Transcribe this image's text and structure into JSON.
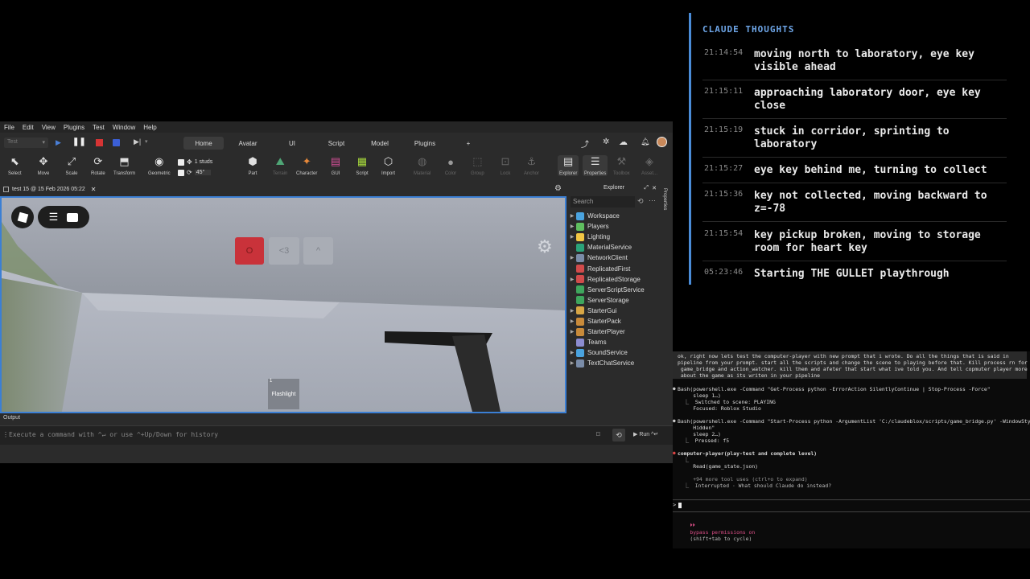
{
  "menu": [
    "File",
    "Edit",
    "View",
    "Plugins",
    "Test",
    "Window",
    "Help"
  ],
  "tabs": [
    "Home",
    "Avatar",
    "UI",
    "Script",
    "Model",
    "Plugins",
    "+"
  ],
  "test_dropdown": "Test",
  "ribbon": {
    "select": "Select",
    "move": "Move",
    "scale": "Scale",
    "rotate": "Rotate",
    "transform": "Transform",
    "geometric": "Geometric",
    "studs": "1 studs",
    "degrees": "45°",
    "part": "Part",
    "terrain": "Terrain",
    "character": "Character",
    "gui": "GUI",
    "script": "Script",
    "import": "Import",
    "material": "Material",
    "color": "Color",
    "group": "Group",
    "lock": "Lock",
    "anchor": "Anchor",
    "explorer": "Explorer",
    "properties": "Properties",
    "toolbox": "Toolbox",
    "asset": "Asset..."
  },
  "doc_tab": "test 15 @ 15 Feb 2026 05:22",
  "game_ui": {
    "hud_btn1": "O",
    "hud_btn2": "<3",
    "hud_btn3": "^",
    "hotbar_slot_num": "1",
    "hotbar_slot_label": "Flashlight"
  },
  "explorer": {
    "title": "Explorer",
    "search_placeholder": "Search",
    "properties_rail": "Properties",
    "items": [
      {
        "label": "Workspace",
        "color": "#4aa3df",
        "arrow": true
      },
      {
        "label": "Players",
        "color": "#5fbf5f",
        "arrow": true
      },
      {
        "label": "Lighting",
        "color": "#f2c744",
        "arrow": true
      },
      {
        "label": "MaterialService",
        "color": "#2ba37a",
        "arrow": false
      },
      {
        "label": "NetworkClient",
        "color": "#7a8ca8",
        "arrow": true
      },
      {
        "label": "ReplicatedFirst",
        "color": "#d24b4b",
        "arrow": false
      },
      {
        "label": "ReplicatedStorage",
        "color": "#d24b4b",
        "arrow": true
      },
      {
        "label": "ServerScriptService",
        "color": "#3fa65d",
        "arrow": false
      },
      {
        "label": "ServerStorage",
        "color": "#3fa65d",
        "arrow": false
      },
      {
        "label": "StarterGui",
        "color": "#d8a645",
        "arrow": true
      },
      {
        "label": "StarterPack",
        "color": "#c88a3a",
        "arrow": true
      },
      {
        "label": "StarterPlayer",
        "color": "#c88a3a",
        "arrow": true
      },
      {
        "label": "Teams",
        "color": "#8c8cd0",
        "arrow": false
      },
      {
        "label": "SoundService",
        "color": "#4aa3df",
        "arrow": true
      },
      {
        "label": "TextChatService",
        "color": "#7a8ca8",
        "arrow": true
      }
    ]
  },
  "output_label": "Output",
  "command_placeholder": "Execute a command with ^↵ or use ^+Up/Down for history",
  "run_label": "Run ^↵",
  "thoughts": {
    "title": "CLAUDE THOUGHTS",
    "entries": [
      {
        "time": "21:14:54",
        "text": "moving north to laboratory, eye key visible ahead"
      },
      {
        "time": "21:15:11",
        "text": "approaching laboratory door, eye key close"
      },
      {
        "time": "21:15:19",
        "text": "stuck in corridor, sprinting to laboratory"
      },
      {
        "time": "21:15:27",
        "text": "eye key behind me, turning to collect"
      },
      {
        "time": "21:15:36",
        "text": "key not collected, moving backward to z=-78"
      },
      {
        "time": "21:15:54",
        "text": "key pickup broken, moving to storage room for heart key"
      },
      {
        "time": "05:23:46",
        "text": "Starting THE GULLET playthrough"
      }
    ]
  },
  "terminal": {
    "prompt_lines": [
      "ok, right now lets test the computer-player with new prompt that i wrote. Do all the things that is said in",
      "pipeline from your prompt. start all the scripts and change the scene to playing before that. Kill process rn for",
      " game_bridge and action_watcher. kill them and afeter that start what ive told you. And tell copmuter player more",
      " about the game as its writen in your pipeline"
    ],
    "block1": [
      "Bash(powershell.exe -Command \"Get-Process python -ErrorAction SilentlyContinue | Stop-Process -Force\"",
      "     sleep 1…)",
      "  ⎿  Switched to scene: PLAYING",
      "     Focused: Roblox Studio"
    ],
    "block2": [
      "Bash(powershell.exe -Command \"Start-Process python -ArgumentList 'C:/claudeblox/scripts/game_bridge.py' -WindowStyle",
      "     Hidden\"",
      "     sleep 2…)",
      "  ⎿  Pressed: f5"
    ],
    "block3": [
      "computer-player(play-test and complete level)",
      "  ⎿",
      "     Read(game_state.json)",
      "",
      "     +94 more tool uses (ctrl+o to expand)",
      "  ⎿  Interrupted · What should Claude do instead?"
    ],
    "input_prompt": ">",
    "status_icon": "⏵⏵",
    "status_bold": "bypass permissions on",
    "status_rest": "(shift+tab to cycle)"
  }
}
